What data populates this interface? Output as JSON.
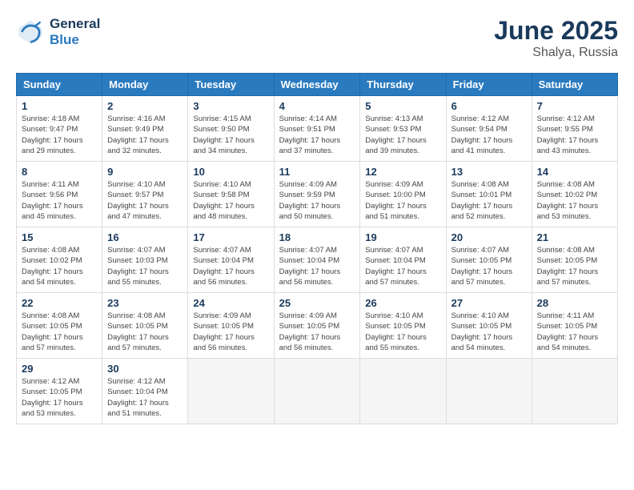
{
  "logo": {
    "line1": "General",
    "line2": "Blue"
  },
  "title": {
    "month": "June 2025",
    "location": "Shalya, Russia"
  },
  "headers": [
    "Sunday",
    "Monday",
    "Tuesday",
    "Wednesday",
    "Thursday",
    "Friday",
    "Saturday"
  ],
  "weeks": [
    [
      {
        "day": "1",
        "info": "Sunrise: 4:18 AM\nSunset: 9:47 PM\nDaylight: 17 hours\nand 29 minutes."
      },
      {
        "day": "2",
        "info": "Sunrise: 4:16 AM\nSunset: 9:49 PM\nDaylight: 17 hours\nand 32 minutes."
      },
      {
        "day": "3",
        "info": "Sunrise: 4:15 AM\nSunset: 9:50 PM\nDaylight: 17 hours\nand 34 minutes."
      },
      {
        "day": "4",
        "info": "Sunrise: 4:14 AM\nSunset: 9:51 PM\nDaylight: 17 hours\nand 37 minutes."
      },
      {
        "day": "5",
        "info": "Sunrise: 4:13 AM\nSunset: 9:53 PM\nDaylight: 17 hours\nand 39 minutes."
      },
      {
        "day": "6",
        "info": "Sunrise: 4:12 AM\nSunset: 9:54 PM\nDaylight: 17 hours\nand 41 minutes."
      },
      {
        "day": "7",
        "info": "Sunrise: 4:12 AM\nSunset: 9:55 PM\nDaylight: 17 hours\nand 43 minutes."
      }
    ],
    [
      {
        "day": "8",
        "info": "Sunrise: 4:11 AM\nSunset: 9:56 PM\nDaylight: 17 hours\nand 45 minutes."
      },
      {
        "day": "9",
        "info": "Sunrise: 4:10 AM\nSunset: 9:57 PM\nDaylight: 17 hours\nand 47 minutes."
      },
      {
        "day": "10",
        "info": "Sunrise: 4:10 AM\nSunset: 9:58 PM\nDaylight: 17 hours\nand 48 minutes."
      },
      {
        "day": "11",
        "info": "Sunrise: 4:09 AM\nSunset: 9:59 PM\nDaylight: 17 hours\nand 50 minutes."
      },
      {
        "day": "12",
        "info": "Sunrise: 4:09 AM\nSunset: 10:00 PM\nDaylight: 17 hours\nand 51 minutes."
      },
      {
        "day": "13",
        "info": "Sunrise: 4:08 AM\nSunset: 10:01 PM\nDaylight: 17 hours\nand 52 minutes."
      },
      {
        "day": "14",
        "info": "Sunrise: 4:08 AM\nSunset: 10:02 PM\nDaylight: 17 hours\nand 53 minutes."
      }
    ],
    [
      {
        "day": "15",
        "info": "Sunrise: 4:08 AM\nSunset: 10:02 PM\nDaylight: 17 hours\nand 54 minutes."
      },
      {
        "day": "16",
        "info": "Sunrise: 4:07 AM\nSunset: 10:03 PM\nDaylight: 17 hours\nand 55 minutes."
      },
      {
        "day": "17",
        "info": "Sunrise: 4:07 AM\nSunset: 10:04 PM\nDaylight: 17 hours\nand 56 minutes."
      },
      {
        "day": "18",
        "info": "Sunrise: 4:07 AM\nSunset: 10:04 PM\nDaylight: 17 hours\nand 56 minutes."
      },
      {
        "day": "19",
        "info": "Sunrise: 4:07 AM\nSunset: 10:04 PM\nDaylight: 17 hours\nand 57 minutes."
      },
      {
        "day": "20",
        "info": "Sunrise: 4:07 AM\nSunset: 10:05 PM\nDaylight: 17 hours\nand 57 minutes."
      },
      {
        "day": "21",
        "info": "Sunrise: 4:08 AM\nSunset: 10:05 PM\nDaylight: 17 hours\nand 57 minutes."
      }
    ],
    [
      {
        "day": "22",
        "info": "Sunrise: 4:08 AM\nSunset: 10:05 PM\nDaylight: 17 hours\nand 57 minutes."
      },
      {
        "day": "23",
        "info": "Sunrise: 4:08 AM\nSunset: 10:05 PM\nDaylight: 17 hours\nand 57 minutes."
      },
      {
        "day": "24",
        "info": "Sunrise: 4:09 AM\nSunset: 10:05 PM\nDaylight: 17 hours\nand 56 minutes."
      },
      {
        "day": "25",
        "info": "Sunrise: 4:09 AM\nSunset: 10:05 PM\nDaylight: 17 hours\nand 56 minutes."
      },
      {
        "day": "26",
        "info": "Sunrise: 4:10 AM\nSunset: 10:05 PM\nDaylight: 17 hours\nand 55 minutes."
      },
      {
        "day": "27",
        "info": "Sunrise: 4:10 AM\nSunset: 10:05 PM\nDaylight: 17 hours\nand 54 minutes."
      },
      {
        "day": "28",
        "info": "Sunrise: 4:11 AM\nSunset: 10:05 PM\nDaylight: 17 hours\nand 54 minutes."
      }
    ],
    [
      {
        "day": "29",
        "info": "Sunrise: 4:12 AM\nSunset: 10:05 PM\nDaylight: 17 hours\nand 53 minutes."
      },
      {
        "day": "30",
        "info": "Sunrise: 4:12 AM\nSunset: 10:04 PM\nDaylight: 17 hours\nand 51 minutes."
      },
      null,
      null,
      null,
      null,
      null
    ]
  ]
}
